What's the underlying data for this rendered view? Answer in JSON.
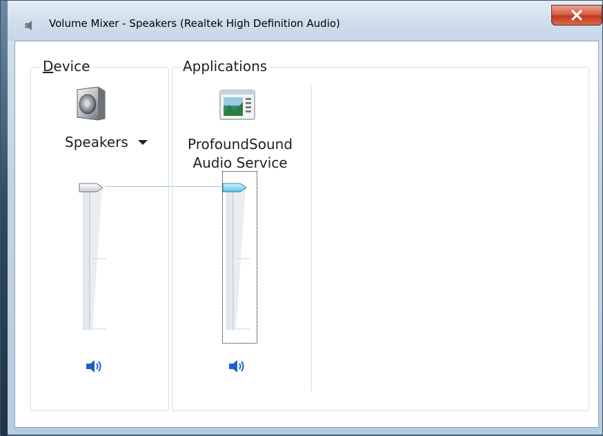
{
  "window": {
    "title": "Volume Mixer - Speakers (Realtek High Definition Audio)",
    "close_label": "x"
  },
  "device_group": {
    "accel": "D",
    "label_rest": "evice",
    "device_name": "Speakers",
    "volume_percent": 100,
    "icon": "speaker-icon",
    "mute_icon": "speaker-volume-icon"
  },
  "apps_group": {
    "label": "Applications",
    "apps": [
      {
        "name_line1": "ProfoundSound",
        "name_line2": "Audio Service",
        "volume_percent": 100,
        "icon": "application-window-icon",
        "mute_icon": "speaker-volume-icon"
      }
    ]
  },
  "colors": {
    "accent_blue": "#1b63c6",
    "close_red": "#c2381f",
    "thumb_active": "#7fd3f0"
  }
}
